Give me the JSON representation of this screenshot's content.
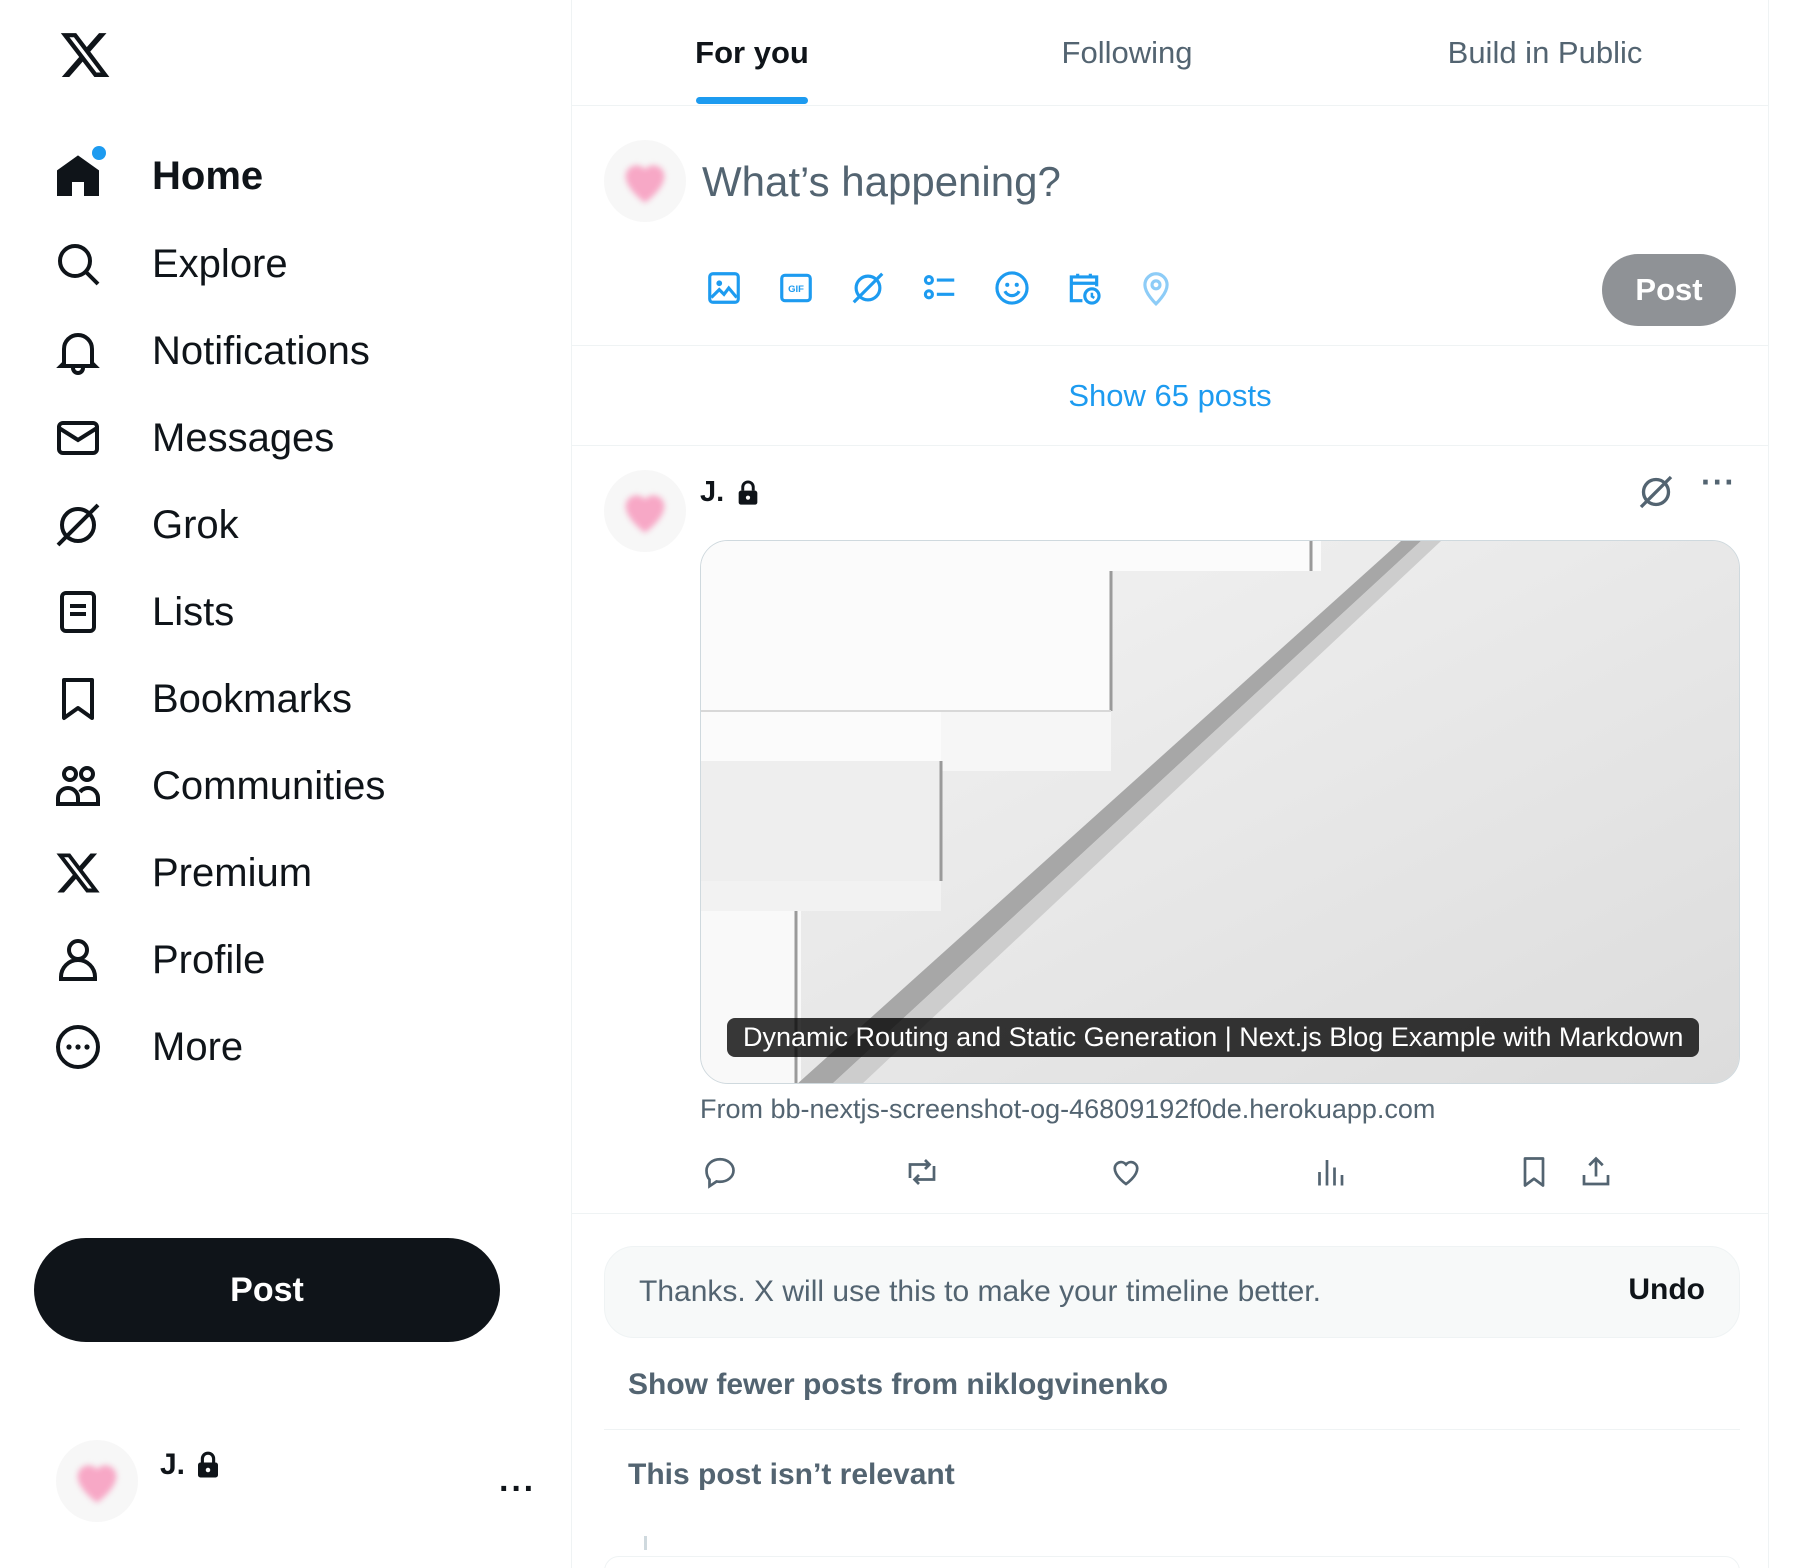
{
  "sidebar": {
    "logo": "x-logo",
    "items": [
      {
        "label": "Home",
        "icon": "home-icon",
        "active": true
      },
      {
        "label": "Explore",
        "icon": "search-icon"
      },
      {
        "label": "Notifications",
        "icon": "bell-icon"
      },
      {
        "label": "Messages",
        "icon": "mail-icon"
      },
      {
        "label": "Grok",
        "icon": "grok-icon"
      },
      {
        "label": "Lists",
        "icon": "lists-icon"
      },
      {
        "label": "Bookmarks",
        "icon": "bookmark-icon"
      },
      {
        "label": "Communities",
        "icon": "communities-icon"
      },
      {
        "label": "Premium",
        "icon": "x-premium-icon"
      },
      {
        "label": "Profile",
        "icon": "person-icon"
      },
      {
        "label": "More",
        "icon": "more-circle-icon"
      }
    ],
    "post_label": "Post",
    "account": {
      "name": "J.",
      "more": "···"
    }
  },
  "tabs": [
    {
      "label": "For you",
      "active": true
    },
    {
      "label": "Following"
    },
    {
      "label": "Build in Public"
    }
  ],
  "composer": {
    "placeholder": "What’s happening?",
    "tools": [
      "image-icon",
      "gif-icon",
      "grok-icon",
      "poll-icon",
      "emoji-icon",
      "schedule-icon",
      "location-icon"
    ],
    "post_label": "Post"
  },
  "show_posts": "Show 65 posts",
  "post": {
    "author": "J.",
    "more": "···",
    "card_caption": "Dynamic Routing and Static Generation | Next.js Blog Example with Markdown",
    "card_source": "From bb-nextjs-screenshot-og-46809192f0de.herokuapp.com",
    "actions": [
      "reply-icon",
      "repost-icon",
      "like-icon",
      "views-icon",
      "bookmark-icon",
      "share-icon"
    ]
  },
  "feedback": {
    "text": "Thanks. X will use this to make your timeline better.",
    "undo": "Undo",
    "reasons": [
      "Show fewer posts from niklogvinenko",
      "This post isn’t relevant"
    ]
  },
  "colors": {
    "accent": "#1d9bf0",
    "text": "#0f1419",
    "muted": "#536471",
    "avatar_heart": "#f7a8c6"
  }
}
